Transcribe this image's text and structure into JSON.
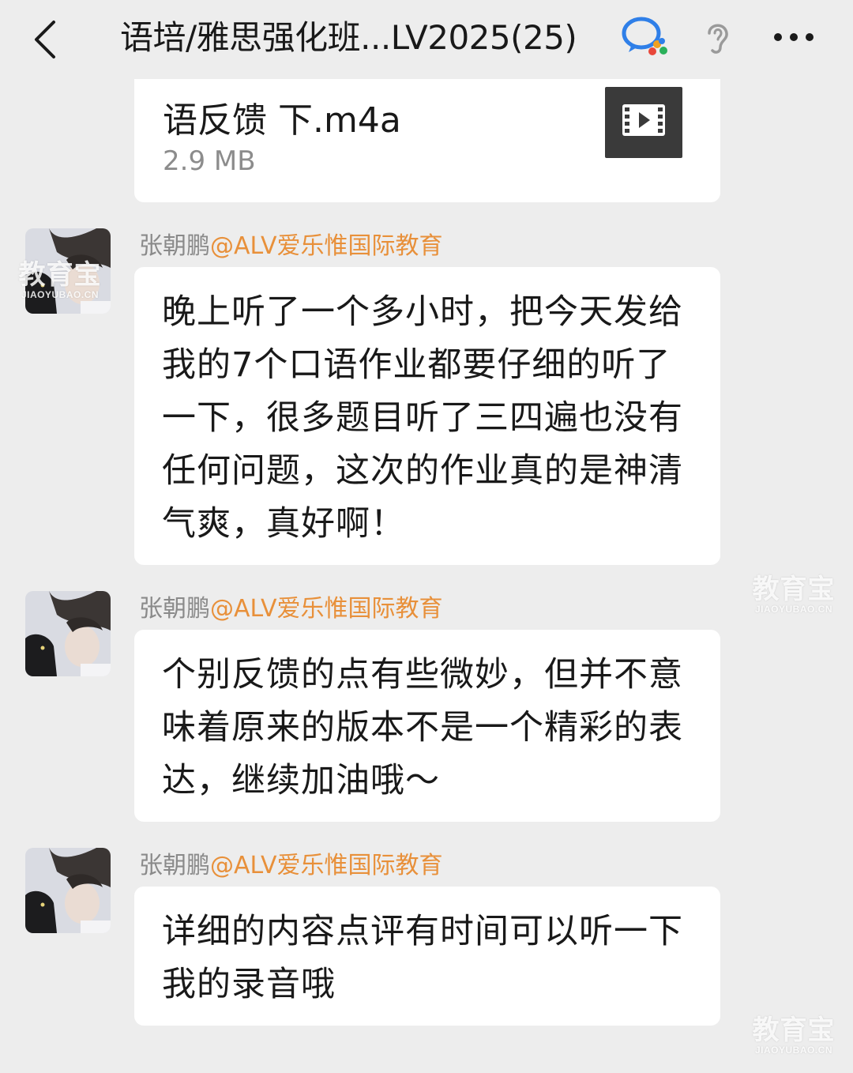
{
  "header": {
    "title": "语培/雅思强化班...LV2025(25)",
    "icons": [
      "back-arrow-icon",
      "wecom-chat-icon",
      "ear-icon",
      "more-icon"
    ]
  },
  "file_message": {
    "name": "语反馈 下.m4a",
    "size": "2.9 MB",
    "icon": "video-file-icon"
  },
  "messages": [
    {
      "sender_name": "张朝鹏",
      "sender_org": "@ALV爱乐惟国际教育",
      "text": "晚上听了一个多小时，把今天发给我的7个口语作业都要仔细的听了一下，很多题目听了三四遍也没有任何问题，这次的作业真的是神清气爽，真好啊！"
    },
    {
      "sender_name": "张朝鹏",
      "sender_org": "@ALV爱乐惟国际教育",
      "text": "个别反馈的点有些微妙，但并不意味着原来的版本不是一个精彩的表达，继续加油哦～"
    },
    {
      "sender_name": "张朝鹏",
      "sender_org": "@ALV爱乐惟国际教育",
      "text": "详细的内容点评有时间可以听一下我的录音哦"
    }
  ],
  "watermark": {
    "main": "教育宝",
    "sub": "JIAOYUBAO.CN"
  },
  "colors": {
    "background": "#ededed",
    "bubble": "#ffffff",
    "org_accent": "#e8903a"
  }
}
